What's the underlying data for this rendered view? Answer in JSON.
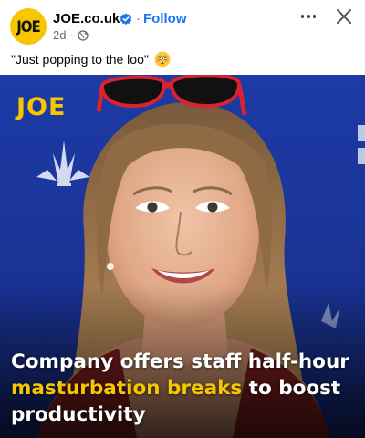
{
  "post": {
    "avatar_text": "JOE",
    "page_name": "JOE.co.uk",
    "separator": "·",
    "follow_label": "Follow",
    "timestamp": "2d",
    "meta_separator": "·",
    "caption": "\"Just popping to the loo\"",
    "icons": {
      "verified": "verified-badge-icon",
      "privacy": "globe-icon",
      "more": "more-options-icon",
      "close": "close-icon",
      "emoji": "flushed-face-emoji"
    }
  },
  "image": {
    "brand": "JOE",
    "headline_part1": "Company offers staff half-hour ",
    "headline_highlight": "masturbation breaks",
    "headline_part2": " to boost productivity"
  },
  "colors": {
    "brand_yellow": "#f7c600",
    "follow_blue": "#1877f2",
    "background_blue": "#1d3aa6",
    "meta_gray": "#65676b"
  }
}
